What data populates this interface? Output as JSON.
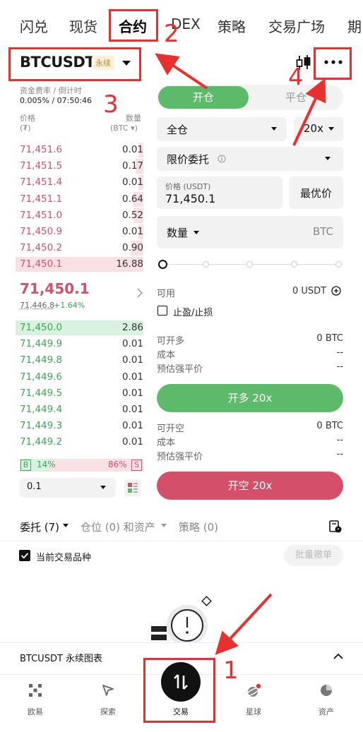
{
  "top_tabs": [
    {
      "label": "闪兑"
    },
    {
      "label": "现货"
    },
    {
      "label": "合约"
    },
    {
      "label": "DEX"
    },
    {
      "label": "策略"
    },
    {
      "label": "交易广场"
    },
    {
      "label": "期"
    }
  ],
  "symbol": {
    "name": "BTCUSDT",
    "badge": "永续"
  },
  "funding": {
    "label": "资金费率 / 倒计时",
    "value": "0.005% / 07:50:46"
  },
  "orderbook": {
    "price_header": "价格",
    "price_unit": "(₮)",
    "qty_header": "数量",
    "qty_unit": "(BTC ▾)",
    "asks": [
      {
        "price": "71,451.6",
        "qty": "0.01",
        "depth": 0.04
      },
      {
        "price": "71,451.5",
        "qty": "0.17",
        "depth": 0.06
      },
      {
        "price": "71,451.4",
        "qty": "0.01",
        "depth": 0.04
      },
      {
        "price": "71,451.1",
        "qty": "0.64",
        "depth": 0.08
      },
      {
        "price": "71,451.0",
        "qty": "0.52",
        "depth": 0.08
      },
      {
        "price": "71,450.9",
        "qty": "0.01",
        "depth": 0.04
      },
      {
        "price": "71,450.2",
        "qty": "0.90",
        "depth": 0.1
      },
      {
        "price": "71,450.1",
        "qty": "16.88",
        "depth": 1.0
      }
    ],
    "last_price": "71,450.1",
    "mark_price": "71,446.8",
    "change": "+1.64%",
    "bids": [
      {
        "price": "71,450.0",
        "qty": "2.86",
        "depth": 1.0
      },
      {
        "price": "71,449.9",
        "qty": "0.01",
        "depth": 0.0
      },
      {
        "price": "71,449.8",
        "qty": "0.01",
        "depth": 0.0
      },
      {
        "price": "71,449.6",
        "qty": "0.01",
        "depth": 0.0
      },
      {
        "price": "71,449.5",
        "qty": "0.01",
        "depth": 0.0
      },
      {
        "price": "71,449.4",
        "qty": "0.01",
        "depth": 0.0
      },
      {
        "price": "71,449.3",
        "qty": "0.01",
        "depth": 0.0
      },
      {
        "price": "71,449.2",
        "qty": "0.01",
        "depth": 0.0
      }
    ],
    "buy_badge": "B",
    "buy_pct": "14%",
    "sell_pct": "86%",
    "sell_badge": "S",
    "precision": "0.1"
  },
  "order_panel": {
    "open_tab": "开仓",
    "close_tab": "平仓",
    "margin_mode": "全仓",
    "leverage": "20x",
    "order_type": "限价委托",
    "price_label": "价格 (USDT)",
    "price_value": "71,450.1",
    "best_price": "最优价",
    "qty_label": "数量",
    "qty_unit": "BTC",
    "available_label": "可用",
    "available_value": "0 USDT",
    "tpsl_label": "止盈/止损",
    "long": {
      "can_open_label": "可开多",
      "can_open_value": "0 BTC",
      "cost_label": "成本",
      "cost_value": "--",
      "liq_label": "预估强平价",
      "liq_value": "--",
      "button": "开多 20x"
    },
    "short": {
      "can_open_label": "可开空",
      "can_open_value": "0 BTC",
      "cost_label": "成本",
      "cost_value": "--",
      "liq_label": "预估强平价",
      "liq_value": "--",
      "button": "开空 20x"
    }
  },
  "orders_tabs": {
    "orders": "委托 (7)",
    "positions": "仓位 (0) 和资产",
    "strategy": "策略 (0)"
  },
  "filter": {
    "current_symbol": "当前交易品种",
    "cancel_all": "批量撤单"
  },
  "chart_bar": {
    "label": "BTCUSDT 永续图表"
  },
  "bottom_nav": [
    {
      "label": "欧易",
      "icon": "okx-logo-icon"
    },
    {
      "label": "探索",
      "icon": "compass-icon"
    },
    {
      "label": "交易",
      "icon": "trade-icon"
    },
    {
      "label": "星球",
      "icon": "planet-icon"
    },
    {
      "label": "资产",
      "icon": "pie-chart-icon"
    }
  ],
  "annotations": [
    "1",
    "2",
    "3",
    "4"
  ],
  "colors": {
    "green": "#5dba6b",
    "red": "#d4506a",
    "annotation": "#e8302f"
  }
}
